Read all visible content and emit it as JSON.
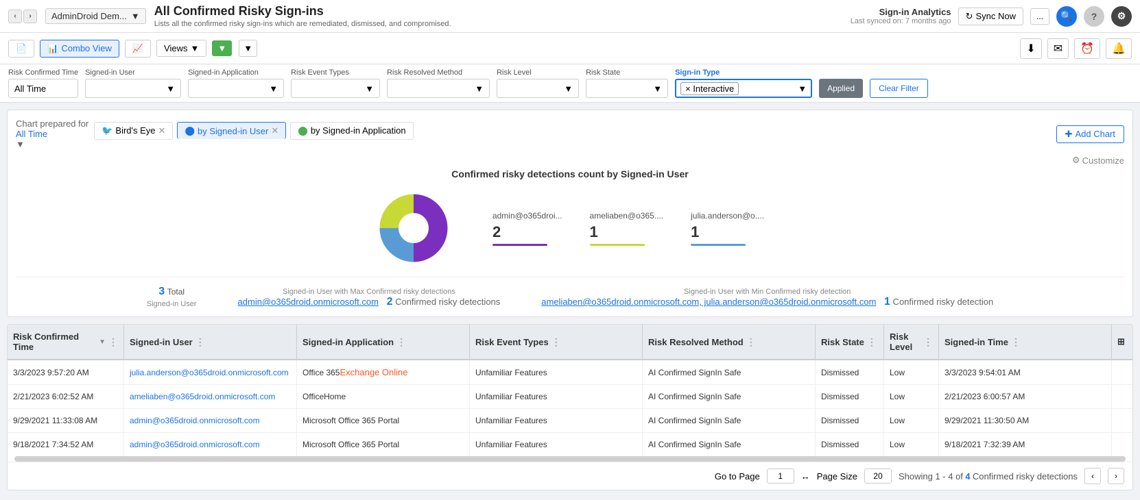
{
  "header": {
    "nav_back": "‹",
    "nav_forward": "›",
    "tenant": "AdminDroid Dem...",
    "title": "All Confirmed Risky Sign-ins",
    "subtitle": "Lists all the confirmed risky sign-ins which are remediated, dismissed, and compromised.",
    "analytics_title": "Sign-in Analytics",
    "sync_label": "Last synced on: 7 months ago",
    "sync_btn": "Sync Now",
    "more_btn": "...",
    "search_icon": "🔍",
    "help_icon": "?",
    "settings_icon": "⚙"
  },
  "toolbar": {
    "doc_icon": "📄",
    "combo_view_label": "Combo View",
    "chart_icon": "📊",
    "views_label": "Views",
    "filter_icon": "▼"
  },
  "filters": {
    "risk_confirmed_time_label": "Risk Confirmed Time",
    "risk_confirmed_time_value": "All Time",
    "signed_in_user_label": "Signed-in User",
    "signed_in_user_placeholder": "",
    "signed_in_app_label": "Signed-in Application",
    "signed_in_app_placeholder": "",
    "risk_event_types_label": "Risk Event Types",
    "risk_event_types_placeholder": "",
    "risk_resolved_method_label": "Risk Resolved Method",
    "risk_resolved_method_placeholder": "",
    "risk_level_label": "Risk Level",
    "risk_level_placeholder": "",
    "risk_state_label": "Risk State",
    "risk_state_placeholder": "",
    "sign_in_type_label": "Sign-in Type",
    "sign_in_type_tag": "× Interactive",
    "applied_label": "Applied",
    "clear_filter_label": "Clear Filter"
  },
  "chart": {
    "tabs": [
      {
        "id": "birds-eye",
        "label": "Bird's Eye",
        "icon": "🐦",
        "closable": true
      },
      {
        "id": "by-signed-in-user",
        "label": "by Signed-in User",
        "icon": "🔵",
        "closable": true,
        "active": true
      },
      {
        "id": "by-signed-in-app",
        "label": "by Signed-in Application",
        "icon": "🟢",
        "closable": false
      }
    ],
    "chart_prepared_for": "Chart prepared for",
    "all_time_label": "All Time",
    "add_chart_label": "Add Chart",
    "customize_label": "Customize",
    "title": "Confirmed risky detections count by Signed-in User",
    "legend": [
      {
        "email": "admin@o365droi...",
        "count": "2",
        "color": "#7b2fbe"
      },
      {
        "email": "ameliaben@o365....",
        "count": "1",
        "color": "#c6d935"
      },
      {
        "email": "julia.anderson@o....",
        "count": "1",
        "color": "#5b9bd5"
      }
    ],
    "stats": [
      {
        "number": "3",
        "label": "Total",
        "sublabel": "Signed-in User"
      },
      {
        "sublabel": "Signed-in User with Max Confirmed risky detections",
        "link": "admin@o365droid.onmicrosoft.com",
        "number": "2",
        "numberlabel": "Confirmed risky detections"
      },
      {
        "sublabel": "Signed-in User with Min Confirmed risky detection",
        "link": "ameliaben@o365droid.onmicrosoft.com, julia.anderson@o365droid.onmicrosoft.com",
        "number": "1",
        "numberlabel": "Confirmed risky detection"
      }
    ]
  },
  "table": {
    "columns": [
      {
        "id": "risk-confirmed-time",
        "label": "Risk Confirmed Time"
      },
      {
        "id": "signed-in-user",
        "label": "Signed-in User"
      },
      {
        "id": "signed-in-application",
        "label": "Signed-in Application"
      },
      {
        "id": "risk-event-types",
        "label": "Risk Event Types"
      },
      {
        "id": "risk-resolved-method",
        "label": "Risk Resolved Method"
      },
      {
        "id": "risk-state",
        "label": "Risk State"
      },
      {
        "id": "risk-level",
        "label": "Risk Level"
      },
      {
        "id": "signed-in-time",
        "label": "Signed-in Time"
      }
    ],
    "rows": [
      {
        "risk_confirmed_time": "3/3/2023 9:57:20 AM",
        "signed_in_user": "julia.anderson@o365droid.onmicrosoft.com",
        "signed_in_application": "Office 365 Exchange Online",
        "app_highlight": "Exchange Online",
        "risk_event_types": "Unfamiliar Features",
        "risk_resolved_method": "AI Confirmed SignIn Safe",
        "risk_state": "Dismissed",
        "risk_level": "Low",
        "signed_in_time": "3/3/2023 9:54:01 AM"
      },
      {
        "risk_confirmed_time": "2/21/2023 6:02:52 AM",
        "signed_in_user": "ameliaben@o365droid.onmicrosoft.com",
        "signed_in_application": "OfficeHome",
        "app_highlight": "",
        "risk_event_types": "Unfamiliar Features",
        "risk_resolved_method": "AI Confirmed SignIn Safe",
        "risk_state": "Dismissed",
        "risk_level": "Low",
        "signed_in_time": "2/21/2023 6:00:57 AM"
      },
      {
        "risk_confirmed_time": "9/29/2021 11:33:08 AM",
        "signed_in_user": "admin@o365droid.onmicrosoft.com",
        "signed_in_application": "Microsoft Office 365 Portal",
        "app_highlight": "",
        "risk_event_types": "Unfamiliar Features",
        "risk_resolved_method": "AI Confirmed SignIn Safe",
        "risk_state": "Dismissed",
        "risk_level": "Low",
        "signed_in_time": "9/29/2021 11:30:50 AM"
      },
      {
        "risk_confirmed_time": "9/18/2021 7:34:52 AM",
        "signed_in_user": "admin@o365droid.onmicrosoft.com",
        "signed_in_application": "Microsoft Office 365 Portal",
        "app_highlight": "",
        "risk_event_types": "Unfamiliar Features",
        "risk_resolved_method": "AI Confirmed SignIn Safe",
        "risk_state": "Dismissed",
        "risk_level": "Low",
        "signed_in_time": "9/18/2021 7:32:39 AM"
      }
    ]
  },
  "pagination": {
    "go_to_page_label": "Go to Page",
    "page_value": "1",
    "arrow": "↔",
    "page_size_label": "Page Size",
    "page_size_value": "20",
    "showing_text": "Showing 1 - 4 of",
    "count": "4",
    "count_label": "Confirmed risky detections",
    "prev_icon": "‹",
    "next_icon": "›"
  }
}
